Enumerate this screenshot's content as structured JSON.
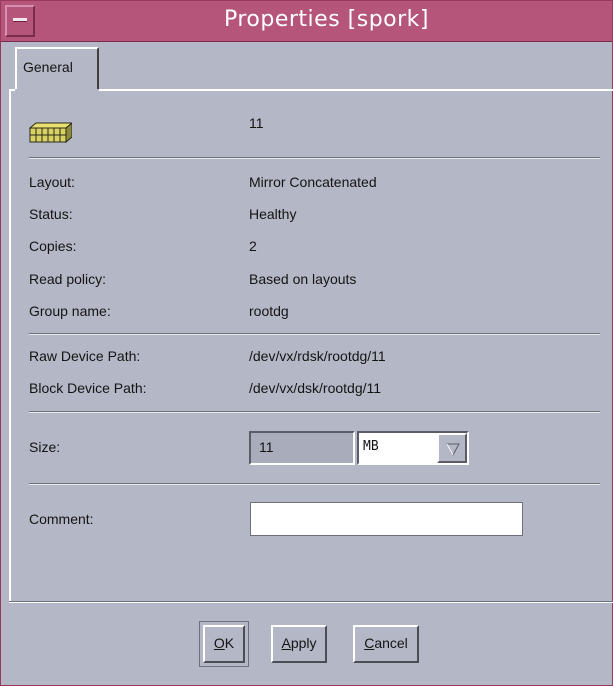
{
  "window": {
    "title": "Properties [spork]"
  },
  "tabs": [
    {
      "label": "General",
      "active": true
    }
  ],
  "header": {
    "volume_name": "11",
    "icon": "volume-icon"
  },
  "properties": [
    {
      "label": "Layout:",
      "value": "Mirror Concatenated"
    },
    {
      "label": "Status:",
      "value": "Healthy"
    },
    {
      "label": "Copies:",
      "value": "2"
    },
    {
      "label": "Read policy:",
      "value": "Based on layouts"
    },
    {
      "label": "Group name:",
      "value": "rootdg"
    }
  ],
  "paths": [
    {
      "label": "Raw Device Path:",
      "value": "/dev/vx/rdsk/rootdg/11"
    },
    {
      "label": "Block Device Path:",
      "value": "/dev/vx/dsk/rootdg/11"
    }
  ],
  "size": {
    "label": "Size:",
    "value": "11",
    "unit": "MB"
  },
  "comment": {
    "label": "Comment:",
    "value": ""
  },
  "buttons": {
    "ok": {
      "mnemonic": "O",
      "rest": "K"
    },
    "apply": {
      "mnemonic": "A",
      "rest": "pply"
    },
    "cancel": {
      "mnemonic": "C",
      "rest": "ancel"
    }
  },
  "colors": {
    "titlebar": "#b5557a",
    "background": "#b4b7c6"
  }
}
